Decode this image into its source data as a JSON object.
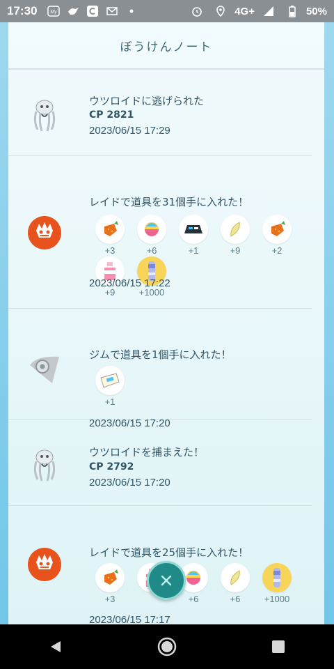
{
  "statusbar": {
    "time": "17:30",
    "network": "4G+",
    "battery": "50%",
    "icons": [
      "my-app-icon",
      "bird-icon",
      "c-app-icon",
      "mail-icon",
      "dot-icon",
      "alarm-icon",
      "location-icon",
      "signal-icon",
      "battery-icon"
    ]
  },
  "header": {
    "title": "ぼうけんノート"
  },
  "entries": [
    {
      "icon": "pokemon-icon",
      "title": "ウツロイドに逃げられた",
      "cp": "CP 2821",
      "timestamp": "2023/06/15 17:29"
    },
    {
      "icon": "raid-icon",
      "title": "レイドで道具を31個手に入れた！",
      "items": [
        {
          "icon": "berry-icon",
          "qty": "+3"
        },
        {
          "icon": "rare-candy-icon",
          "qty": "+6"
        },
        {
          "icon": "tm-icon",
          "qty": "+1"
        },
        {
          "icon": "silver-pinap-icon",
          "qty": "+9"
        },
        {
          "icon": "berry-icon",
          "qty": "+2"
        },
        {
          "icon": "potion-icon",
          "qty": "+9"
        },
        {
          "icon": "stardust-icon",
          "qty": "+1000"
        }
      ],
      "timestamp": "2023/06/15 17:22"
    },
    {
      "icon": "gym-icon",
      "title": "ジムで道具を1個手に入れた！",
      "items": [
        {
          "icon": "raid-pass-icon",
          "qty": "+1"
        }
      ],
      "timestamp": "2023/06/15 17:20"
    },
    {
      "icon": "pokemon-icon",
      "title": "ウツロイドを捕まえた！",
      "cp": "CP 2792",
      "timestamp": "2023/06/15 17:20"
    },
    {
      "icon": "raid-icon",
      "title": "レイドで道具を25個手に入れた！",
      "items": [
        {
          "icon": "berry-icon",
          "qty": "+3"
        },
        {
          "icon": "potion-icon",
          "qty": ""
        },
        {
          "icon": "rare-candy-icon",
          "qty": "+6"
        },
        {
          "icon": "silver-pinap-icon",
          "qty": "+6"
        },
        {
          "icon": "stardust-icon",
          "qty": "+1000"
        }
      ],
      "timestamp": "2023/06/15 17:17"
    }
  ],
  "colors": {
    "panel_bg": "#e9f7fa",
    "text": "#2f5566",
    "fab": "#1f8a88",
    "raid_orange": "#e8531d",
    "stardust_gold": "#f8d559"
  }
}
